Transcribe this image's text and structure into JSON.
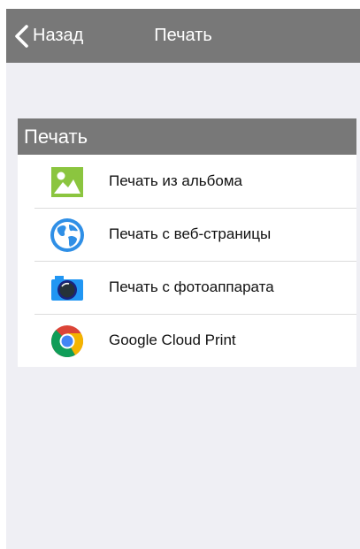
{
  "nav": {
    "back_label": "Назад",
    "title": "Печать"
  },
  "section": {
    "header": "Печать",
    "items": [
      {
        "label": "Печать из альбома",
        "icon": "photo-album-icon"
      },
      {
        "label": "Печать с веб-страницы",
        "icon": "globe-icon"
      },
      {
        "label": "Печать с фотоаппарата",
        "icon": "camera-icon"
      },
      {
        "label": "Google Cloud Print",
        "icon": "chrome-icon"
      }
    ]
  },
  "colors": {
    "navbar": "#787878",
    "background": "#efeff4",
    "row_background": "#ffffff",
    "separator": "#dcdcdc",
    "album_green": "#8bc53f",
    "globe_blue": "#2f8fe6",
    "camera_blue": "#2196f3"
  }
}
